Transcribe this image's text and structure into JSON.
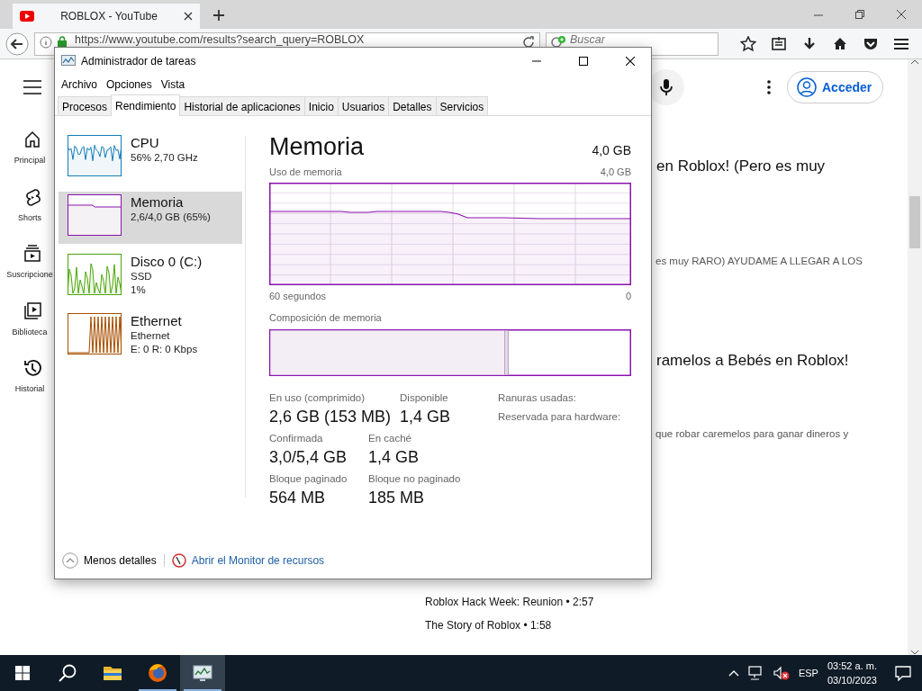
{
  "browser": {
    "tab": {
      "title": "ROBLOX - YouTube"
    },
    "url": "https://www.youtube.com/results?search_query=ROBLOX",
    "search": {
      "placeholder": "Buscar"
    }
  },
  "youtube": {
    "sidebar": [
      {
        "kind": "home",
        "label": "Principal"
      },
      {
        "kind": "shorts",
        "label": "Shorts"
      },
      {
        "kind": "subscriptions",
        "label": "Suscripcione"
      },
      {
        "kind": "library",
        "label": "Biblioteca"
      },
      {
        "kind": "history",
        "label": "Historial"
      }
    ],
    "sign_in": "Acceder",
    "results": [
      {
        "kind": "title",
        "text": "en Roblox! (Pero es muy"
      },
      {
        "kind": "description",
        "text": "es muy RARO) AYUDAME A LLEGAR A LOS"
      },
      {
        "kind": "title",
        "text": "ramelos a Bebés en Roblox!"
      },
      {
        "kind": "description",
        "text": "que robar caremelos para ganar dineros y"
      }
    ],
    "related": [
      "Roblox Hack Week: Reunion • 2:57",
      "The Story of Roblox • 1:58"
    ]
  },
  "task_manager": {
    "title": "Administrador de tareas",
    "menu": [
      "Archivo",
      "Opciones",
      "Vista"
    ],
    "tabs": [
      {
        "label": "Procesos",
        "selected": false
      },
      {
        "label": "Rendimiento",
        "selected": true
      },
      {
        "label": "Historial de aplicaciones",
        "selected": false
      },
      {
        "label": "Inicio",
        "selected": false
      },
      {
        "label": "Usuarios",
        "selected": false
      },
      {
        "label": "Detalles",
        "selected": false
      },
      {
        "label": "Servicios",
        "selected": false
      }
    ],
    "resources": [
      {
        "kind": "cpu",
        "name": "CPU",
        "lines": [
          "56% 2,70 GHz"
        ],
        "selected": false
      },
      {
        "kind": "memory",
        "name": "Memoria",
        "lines": [
          "2,6/4,0 GB (65%)"
        ],
        "selected": true
      },
      {
        "kind": "disk",
        "name": "Disco 0 (C:)",
        "lines": [
          "SSD",
          "1%"
        ],
        "selected": false
      },
      {
        "kind": "network",
        "name": "Ethernet",
        "lines": [
          "Ethernet",
          "E: 0 R: 0 Kbps"
        ],
        "selected": false
      }
    ],
    "detail": {
      "title": "Memoria",
      "total": "4,0 GB",
      "graph_label": "Uso de memoria",
      "graph_max": "4,0 GB",
      "time_start": "60 segundos",
      "time_end": "0",
      "composition_label": "Composición de memoria",
      "stats": [
        [
          {
            "label": "En uso (comprimido)",
            "value": "2,6 GB (153 MB)"
          },
          {
            "label": "Disponible",
            "value": "1,4 GB"
          }
        ],
        [
          {
            "label": "Confirmada",
            "value": "3,0/5,4 GB"
          },
          {
            "label": "En caché",
            "value": "1,4 GB"
          }
        ],
        [
          {
            "label": "Bloque paginado",
            "value": "564 MB"
          },
          {
            "label": "Bloque no paginado",
            "value": "185 MB"
          }
        ]
      ],
      "side_stats": [
        "Ranuras usadas:",
        "Reservada para hardware:"
      ]
    },
    "footer": {
      "fewer_details": "Menos detalles",
      "resource_monitor": "Abrir el Monitor de recursos"
    }
  },
  "taskbar": {
    "apps": [
      {
        "kind": "explorer",
        "running": false,
        "selected": false
      },
      {
        "kind": "firefox",
        "running": true,
        "selected": false
      },
      {
        "kind": "taskmanager",
        "running": true,
        "selected": true
      }
    ],
    "language": "ESP",
    "time": "03:52 a. m.",
    "date": "03/10/2023"
  }
}
